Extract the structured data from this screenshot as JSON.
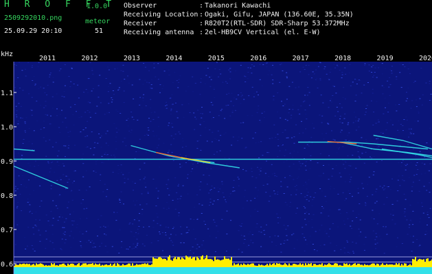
{
  "header": {
    "app_title": "H R O F F T",
    "app_version": "1.0.0",
    "file_name": "2509292010.png",
    "meteor_label": "meteor",
    "date_time": "25.09.29 20:10",
    "meteor_count": "51"
  },
  "info": {
    "observer_key": "Observer",
    "observer_val": "Takanori Kawachi",
    "location_key": "Receiving Location",
    "location_val": "Ogaki, Gifu, JAPAN (136.60E, 35.35N)",
    "receiver_key": "Receiver",
    "receiver_val": "R820T2(RTL-SDR) SDR-Sharp 53.372MHz",
    "antenna_key": "Receiving antenna",
    "antenna_val": "2el-HB9CV Vertical (el. E-W)",
    "separator": ":"
  },
  "chart_data": {
    "type": "heatmap",
    "unit_label": "kHz",
    "y_ticks": [
      "1.1",
      "1.0",
      "0.9",
      "0.8",
      "0.7",
      "0.6"
    ],
    "y_values": [
      1.1,
      1.0,
      0.9,
      0.8,
      0.7,
      0.6
    ],
    "x_ticks": [
      "2011",
      "2012",
      "2013",
      "2014",
      "2015",
      "2016",
      "2017",
      "2018",
      "2019",
      "2020"
    ],
    "ylim": [
      0.57,
      1.19
    ],
    "steady_carrier_khz": 0.905,
    "reference_lines_khz": [
      0.62,
      0.605
    ],
    "colors": {
      "background_noise": "#0b157a",
      "axis_text": "#f2f2f2",
      "header_accent": "#35d55e",
      "carrier": "#33e0e8",
      "histogram_fill": "#ffee00",
      "histogram_base": "#33e0e8"
    }
  }
}
